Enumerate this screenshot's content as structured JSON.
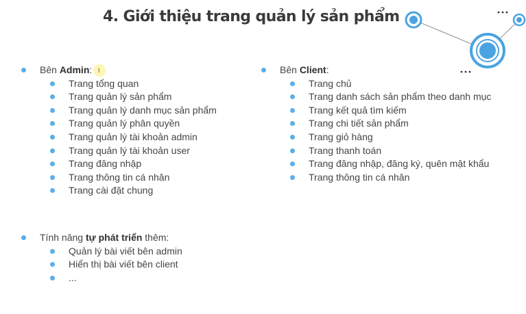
{
  "slide": {
    "title": "4. Giới thiệu trang quản lý sản phẩm",
    "admin": {
      "prefix": "Bên ",
      "bold": "Admin",
      "suffix": ":",
      "items": [
        "Trang tổng quan",
        "Trang quản lý sản phẩm",
        "Trang quản lý danh mục sản phẩm",
        "Trang quản lý phân quyền",
        "Trang quản lý tài khoản admin",
        "Trang quản lý tài khoản user",
        "Trang đăng nhập",
        "Trang thông tin cá nhân",
        "Trang cài đặt chung"
      ]
    },
    "client": {
      "prefix": "Bên ",
      "bold": "Client",
      "suffix": ":",
      "items": [
        "Trang chủ",
        "Trang danh sách sản phẩm theo danh mục",
        "Trang kết quả tìm kiếm",
        "Trang chi tiết sản phẩm",
        "Trang giỏ hàng",
        "Trang thanh toán",
        "Trang đăng nhập, đăng ký, quên mật khẩu",
        "Trang thông tin cá nhân"
      ]
    },
    "features": {
      "prefix": "Tính năng ",
      "bold": "tự phát triển",
      "suffix": " thêm:",
      "items": [
        "Quản lý bài viết bên admin",
        "Hiển thị bài viết bên client",
        "..."
      ]
    }
  },
  "colors": {
    "bullet": "#5aaee9",
    "accent": "#4aa3e0",
    "deco_line": "#999999",
    "title": "#3b3b3b"
  },
  "icons": {
    "decoration": "connected-circles-graphic",
    "ellipsis_top": "dots-icon",
    "ellipsis_bottom": "dots-icon"
  }
}
